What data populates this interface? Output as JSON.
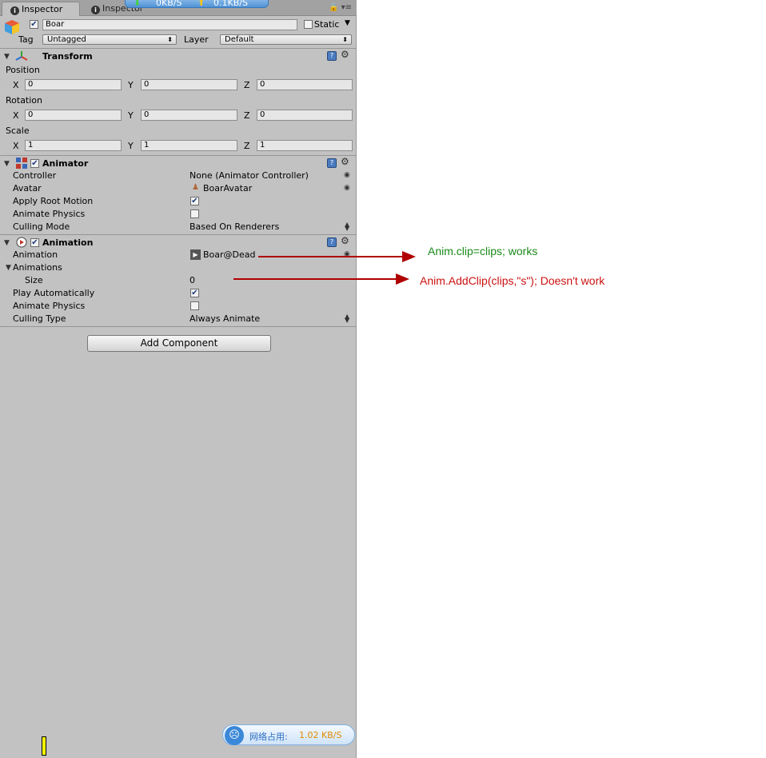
{
  "tabs": {
    "active": "Inspector",
    "inactive": "Inspector",
    "download": "0KB/S",
    "upload": "0.1KB/S"
  },
  "object": {
    "name": "Boar",
    "static_label": "Static",
    "tag_label": "Tag",
    "tag_value": "Untagged",
    "layer_label": "Layer",
    "layer_value": "Default"
  },
  "transform": {
    "title": "Transform",
    "position_label": "Position",
    "rotation_label": "Rotation",
    "scale_label": "Scale",
    "x": "X",
    "y": "Y",
    "z": "Z",
    "position": [
      "0",
      "0",
      "0"
    ],
    "rotation": [
      "0",
      "0",
      "0"
    ],
    "scale": [
      "1",
      "1",
      "1"
    ]
  },
  "animator": {
    "title": "Animator",
    "controller_label": "Controller",
    "controller_value": "None (Animator Controller)",
    "avatar_label": "Avatar",
    "avatar_value": "BoarAvatar",
    "apply_root_label": "Apply Root Motion",
    "animate_physics_label": "Animate Physics",
    "culling_label": "Culling Mode",
    "culling_value": "Based On Renderers"
  },
  "animation": {
    "title": "Animation",
    "animation_label": "Animation",
    "animation_value": "Boar@Dead",
    "animations_label": "Animations",
    "size_label": "Size",
    "size_value": "0",
    "play_auto_label": "Play Automatically",
    "animate_physics_label": "Animate Physics",
    "culling_label": "Culling Type",
    "culling_value": "Always Animate"
  },
  "add_component": "Add Component",
  "network_badge": {
    "label": "网络占用:",
    "value": "1.02 KB/S"
  },
  "annotations": {
    "works": "Anim.clip=clips; works",
    "fails": "Anim.AddClip(clips,\"s\"); Doesn't work"
  },
  "colors": {
    "works_text": "#1a8a1a",
    "fails_text": "#cc1111",
    "arrow": "#b00000"
  }
}
